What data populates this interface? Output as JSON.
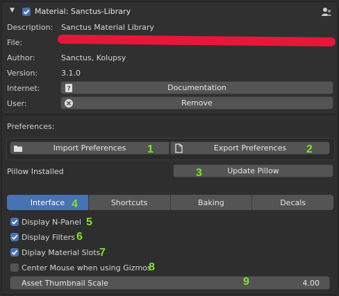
{
  "header": {
    "title": "Material: Sanctus-Library"
  },
  "info": {
    "description_label": "Description:",
    "description_value": "Sanctus Material Library",
    "file_label": "File:",
    "author_label": "Author:",
    "author_value": "Sanctus, Kolupsy",
    "version_label": "Version:",
    "version_value": "3.1.0",
    "internet_label": "Internet:",
    "documentation_button": "Documentation",
    "user_label": "User:",
    "remove_button": "Remove"
  },
  "preferences": {
    "title": "Preferences:",
    "import_button": "Import Preferences",
    "export_button": "Export Preferences",
    "pillow_status": "Pillow Installed",
    "update_pillow_button": "Update Pillow"
  },
  "tabs": [
    "Interface",
    "Shortcuts",
    "Baking",
    "Decals"
  ],
  "options": [
    {
      "label": "Display N-Panel",
      "checked": true
    },
    {
      "label": "Display Filters",
      "checked": true
    },
    {
      "label": "Diplay Material Slots",
      "checked": true
    },
    {
      "label": "Center Mouse when using Gizmos",
      "checked": false
    }
  ],
  "thumbnail_scale": {
    "label": "Asset Thumbnail Scale",
    "value": "4.00"
  },
  "markers": [
    "1",
    "2",
    "3",
    "4",
    "5",
    "6",
    "7",
    "8",
    "9"
  ],
  "colors": {
    "accent": "#4772b3",
    "marker": "#7ee622",
    "redaction": "#e8173a"
  }
}
